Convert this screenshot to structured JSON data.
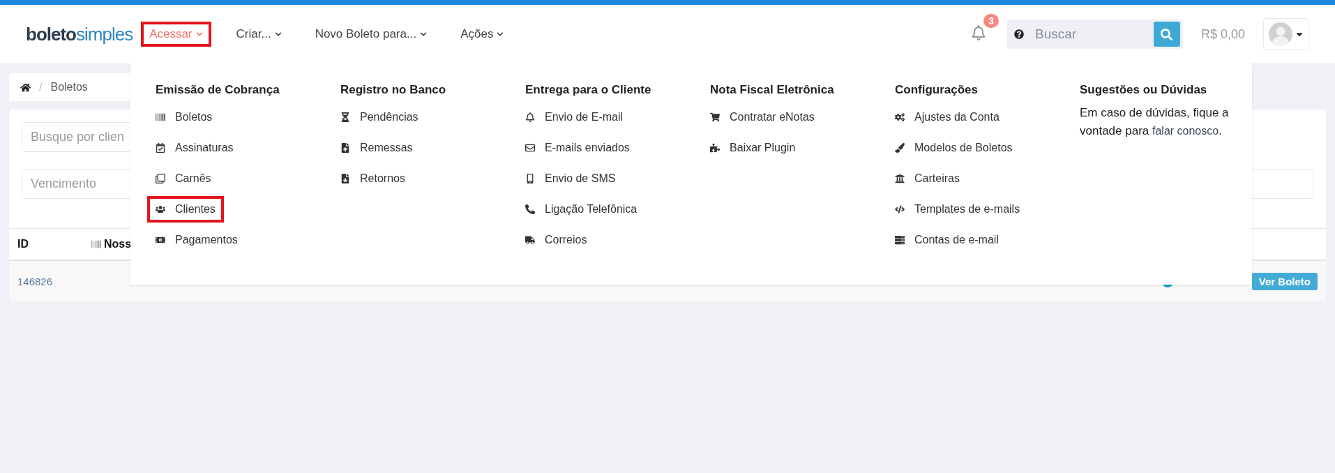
{
  "logo": {
    "dark": "boleto",
    "light": "simples"
  },
  "nav": [
    {
      "label": "Acessar",
      "selected": true,
      "annotated": true
    },
    {
      "label": "Criar...",
      "selected": false,
      "annotated": false
    },
    {
      "label": "Novo Boleto para...",
      "selected": false,
      "annotated": false
    },
    {
      "label": "Ações",
      "selected": false,
      "annotated": false
    }
  ],
  "notifications": {
    "count": "3"
  },
  "search": {
    "placeholder": "Buscar"
  },
  "balance": "R$ 0,00",
  "breadcrumb": [
    "Boletos"
  ],
  "breadcrumb_separator": "/",
  "filters": {
    "search_placeholder": "Busque por clien",
    "due_placeholder": "Vencimento"
  },
  "table": {
    "columns": [
      "ID",
      "Noss"
    ],
    "rows": [
      {
        "id": "146826",
        "action": "Ver Boleto"
      }
    ]
  },
  "menu": {
    "columns": [
      {
        "title": "Emissão de Cobrança",
        "items": [
          {
            "label": "Boletos",
            "annotated": false
          },
          {
            "label": "Assinaturas",
            "annotated": false
          },
          {
            "label": "Carnês",
            "annotated": false
          },
          {
            "label": "Clientes",
            "annotated": true
          },
          {
            "label": "Pagamentos",
            "annotated": false
          }
        ]
      },
      {
        "title": "Registro no Banco",
        "items": [
          {
            "label": "Pendências",
            "annotated": false
          },
          {
            "label": "Remessas",
            "annotated": false
          },
          {
            "label": "Retornos",
            "annotated": false
          }
        ]
      },
      {
        "title": "Entrega para o Cliente",
        "items": [
          {
            "label": "Envio de E-mail",
            "annotated": false
          },
          {
            "label": "E-mails enviados",
            "annotated": false
          },
          {
            "label": "Envio de SMS",
            "annotated": false
          },
          {
            "label": "Ligação Telefônica",
            "annotated": false
          },
          {
            "label": "Correios",
            "annotated": false
          }
        ]
      },
      {
        "title": "Nota Fiscal Eletrônica",
        "items": [
          {
            "label": "Contratar eNotas",
            "annotated": false
          },
          {
            "label": "Baixar Plugin",
            "annotated": false
          }
        ]
      },
      {
        "title": "Configurações",
        "items": [
          {
            "label": "Ajustes da Conta",
            "annotated": false
          },
          {
            "label": "Modelos de Boletos",
            "annotated": false
          },
          {
            "label": "Carteiras",
            "annotated": false
          },
          {
            "label": "Templates de e-mails",
            "annotated": false
          },
          {
            "label": "Contas de e-mail",
            "annotated": false
          }
        ]
      }
    ],
    "help": {
      "title": "Sugestões ou Dúvidas",
      "text": "Em caso de dúvidas, fique a vontade para",
      "link": "falar conosco",
      "suffix": "."
    }
  }
}
